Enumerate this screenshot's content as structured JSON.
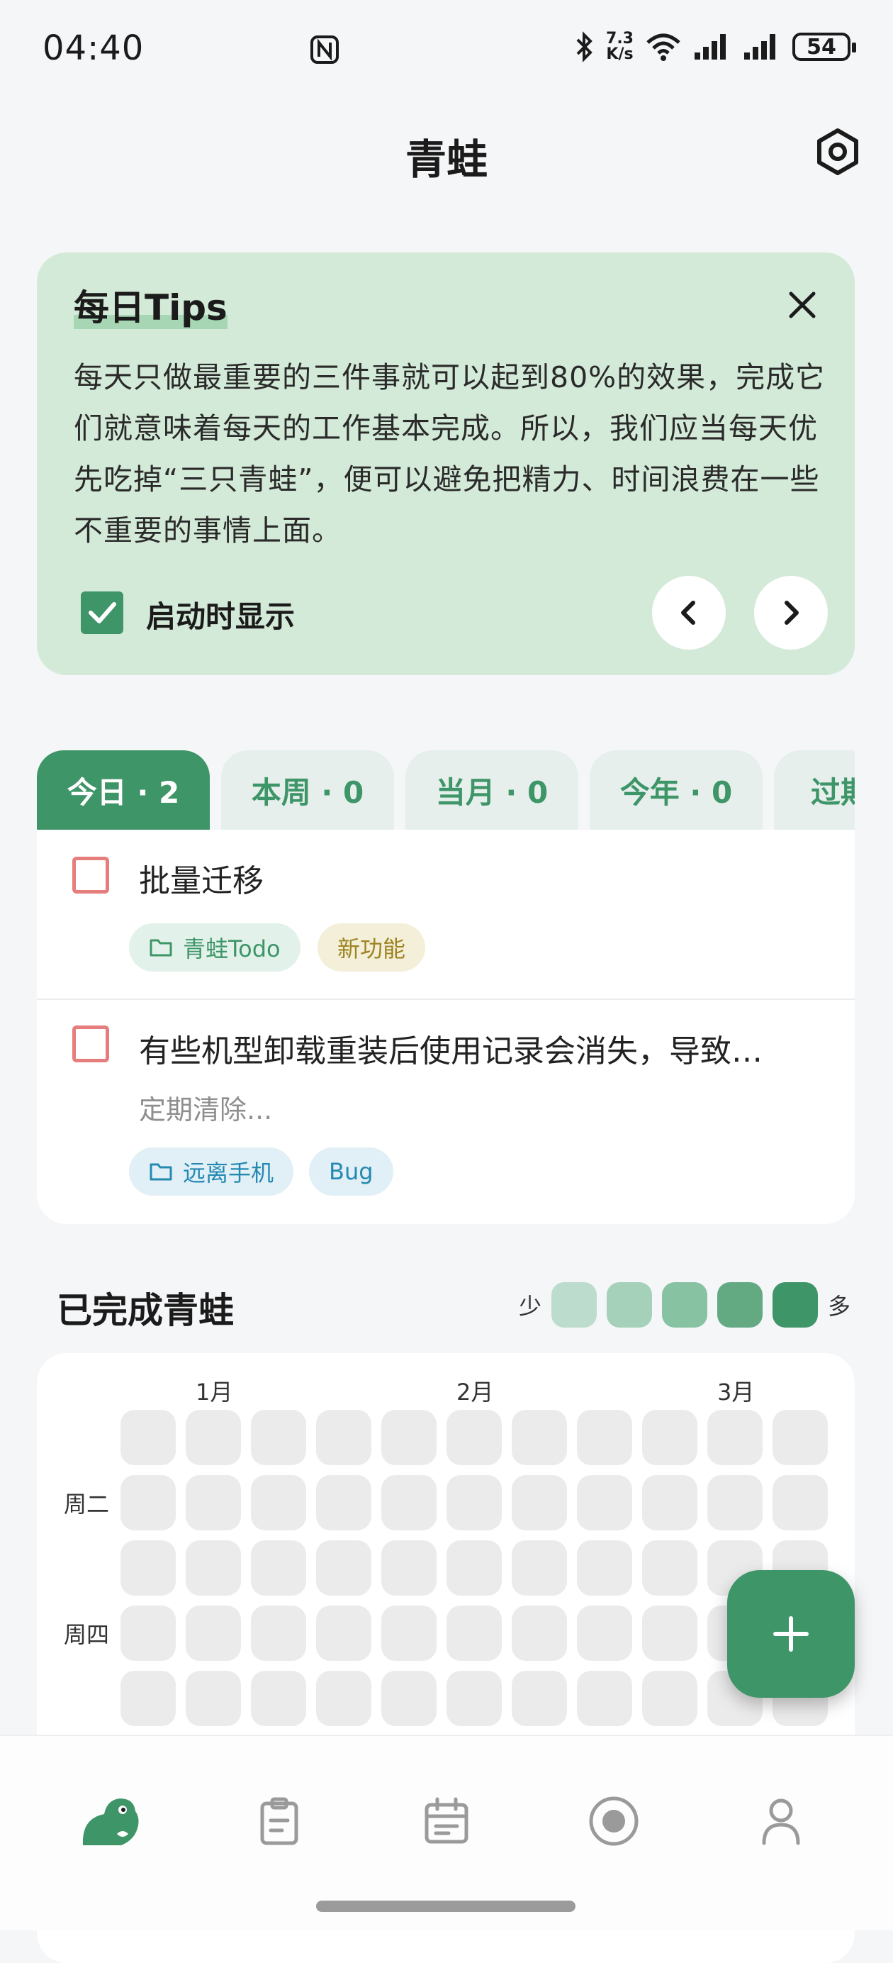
{
  "status_bar": {
    "time": "04:40",
    "net_speed_value": "7.3",
    "net_speed_unit": "K/s",
    "battery": "54",
    "icons": [
      "nfc-icon",
      "bluetooth-icon",
      "wifi-icon",
      "signal-icon",
      "signal-icon",
      "battery-icon"
    ]
  },
  "header": {
    "title": "青蛙",
    "settings_icon": "gear-icon"
  },
  "tips": {
    "title": "每日Tips",
    "body": "每天只做最重要的三件事就可以起到80%的效果，完成它们就意味着每天的工作基本完成。所以，我们应当每天优先吃掉“三只青蛙”，便可以避免把精力、时间浪费在一些不重要的事情上面。",
    "show_on_start_label": "启动时显示",
    "show_on_start_checked": true
  },
  "tabs": [
    {
      "label": "今日 · 2",
      "active": true
    },
    {
      "label": "本周 · 0",
      "active": false
    },
    {
      "label": "当月 · 0",
      "active": false
    },
    {
      "label": "今年 · 0",
      "active": false
    },
    {
      "label": "过期",
      "active": false
    }
  ],
  "todos": [
    {
      "title": "批量迁移",
      "subtitle": "",
      "folder": "青蛙Todo",
      "tag": "新功能"
    },
    {
      "title": "有些机型卸载重装后使用记录会消失，导致…",
      "subtitle": "定期清除...",
      "folder": "远离手机",
      "tag": "Bug"
    }
  ],
  "completed": {
    "title": "已完成青蛙",
    "legend_low": "少",
    "legend_high": "多",
    "legend_colors": [
      "#BCDCCD",
      "#A5D1BA",
      "#87C2A2",
      "#63AA83",
      "#3E9568"
    ],
    "months": [
      "1月",
      "2月",
      "3月"
    ],
    "weekdays": [
      "周二",
      "周四"
    ],
    "empty_cell_color": "#EBEBEB"
  },
  "colors": {
    "accent": "#3E9568",
    "tips_bg": "#D4EAD8",
    "checkbox_border": "#E77E7E"
  },
  "bottom_nav": [
    "frog-icon",
    "clipboard-icon",
    "calendar-icon",
    "target-icon",
    "person-icon"
  ]
}
